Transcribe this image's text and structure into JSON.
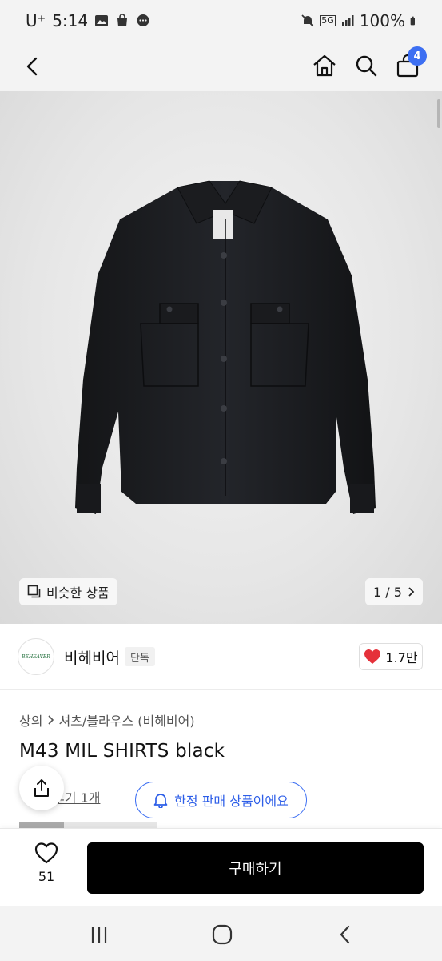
{
  "status_bar": {
    "carrier": "U⁺",
    "time": "5:14",
    "network": "5G",
    "battery": "100%"
  },
  "header": {
    "cart_count": "4"
  },
  "gallery": {
    "similar_label": "비슷한 상품",
    "counter": "1 / 5"
  },
  "brand": {
    "logo_text": "BEHEAVER",
    "name": "비헤비어",
    "exclusive_tag": "단독",
    "like_count": "1.7만"
  },
  "product": {
    "breadcrumb": [
      "상의",
      "셔츠/블라우스 (비헤비어)"
    ],
    "title": "M43 MIL SHIRTS black",
    "review_link": "후기 1개",
    "limited_label": "한정 판매 상품이에요"
  },
  "buy_bar": {
    "wish_count": "51",
    "buy_label": "구매하기"
  },
  "colors": {
    "accent": "#3d6ff2",
    "like_heart": "#e5313a",
    "buy_button": "#000000"
  }
}
